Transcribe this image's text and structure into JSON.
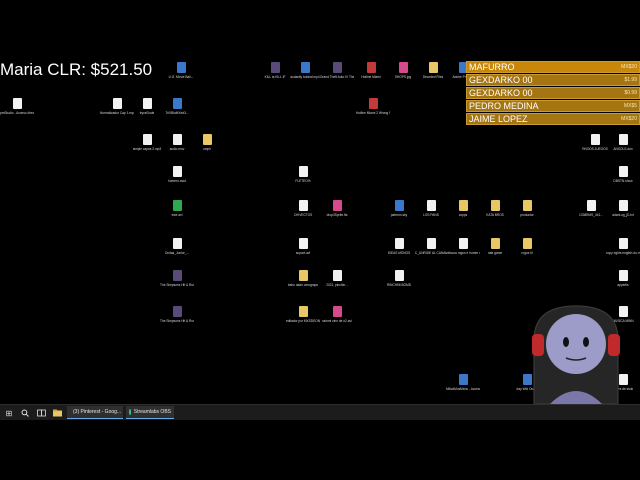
{
  "overlay": {
    "viewer_total": "Maria CLR: $521.50"
  },
  "donations": [
    {
      "name": "MAFURRO",
      "amount": "MX$20"
    },
    {
      "name": "GEXDARKO 00",
      "amount": "$1.99"
    },
    {
      "name": "GEXDARKO 00",
      "amount": "$0.99"
    },
    {
      "name": "PEDRO MEDINA",
      "amount": "MX$5"
    },
    {
      "name": "JAIME LOPEZ",
      "amount": "MX$20"
    }
  ],
  "desktop_icons": [
    {
      "label": "U.G. Movie Ball...",
      "kind": "blue"
    },
    {
      "label": "KILL la KILL IF",
      "kind": "game"
    },
    {
      "label": "audacity tutorial mp4",
      "kind": "blue"
    },
    {
      "label": "Grand Theft Auto IV The Complete...",
      "kind": "game"
    },
    {
      "label": "Hotline Miami",
      "kind": "red"
    },
    {
      "label": "SHOPS.jpg",
      "kind": "pink"
    },
    {
      "label": "Decoded Files",
      "kind": "folder"
    },
    {
      "label": "Adobe Pre Pro",
      "kind": "blue"
    },
    {
      "label": "pmStudio - Acceso directo",
      "kind": "file"
    },
    {
      "label": "Normalizador Cap 1.mp4",
      "kind": "file"
    },
    {
      "label": "tryceDude",
      "kind": "file"
    },
    {
      "label": "TriXBlaMXed3...",
      "kind": "blue"
    },
    {
      "label": "Hotline Miami 2 Wrong Number",
      "kind": "red"
    },
    {
      "label": "simple capas 2.mp3",
      "kind": "file"
    },
    {
      "label": "audio.mov",
      "kind": "file"
    },
    {
      "label": "umph",
      "kind": "folder"
    },
    {
      "label": "RNODS.JUEGOS",
      "kind": "file"
    },
    {
      "label": "ANSOLS.dun",
      "kind": "file"
    },
    {
      "label": "homero.mod",
      "kind": "file"
    },
    {
      "label": "FLETEO%",
      "kind": "file"
    },
    {
      "label": "DBSTN.show",
      "kind": "file"
    },
    {
      "label": "ewe.avi",
      "kind": "green"
    },
    {
      "label": "CHIVECTOS",
      "kind": "file"
    },
    {
      "label": "drop3Sprite.fla",
      "kind": "pink"
    },
    {
      "label": "patreon.sky",
      "kind": "blue"
    },
    {
      "label": "LOS PANS",
      "kind": "file"
    },
    {
      "label": "copps",
      "kind": "folder"
    },
    {
      "label": "KATA BROS",
      "kind": "folder"
    },
    {
      "label": "productor",
      "kind": "folder"
    },
    {
      "label": "1338RMS_341...",
      "kind": "file"
    },
    {
      "label": "adanLog_jD.txt",
      "kind": "file"
    },
    {
      "label": "Ondas_Junior_...",
      "kind": "file"
    },
    {
      "label": "scpoot.avi",
      "kind": "file"
    },
    {
      "label": "IDEAS MONOS",
      "kind": "file"
    },
    {
      "label": "C_UNRIDE AL CANAL",
      "kind": "file"
    },
    {
      "label": "milsoca rogus e homer du tncr...",
      "kind": "file"
    },
    {
      "label": "rafa game",
      "kind": "folder"
    },
    {
      "label": "rogus fil",
      "kind": "folder"
    },
    {
      "label": "copy rights english du.rn...",
      "kind": "file"
    },
    {
      "label": "The Simpsons Hit & Run by Mixer...",
      "kind": "game"
    },
    {
      "label": "baho dado omograpo",
      "kind": "folder"
    },
    {
      "label": "2021, pinchin...",
      "kind": "file"
    },
    {
      "label": "RINCH56 BOMD",
      "kind": "file"
    },
    {
      "label": "appeels",
      "kind": "file"
    },
    {
      "label": "The Simpsons Hit & Run by Mixe...",
      "kind": "game"
    },
    {
      "label": "editador por MXSDEON",
      "kind": "folder"
    },
    {
      "label": "ssinmi cinn de o2.avi",
      "kind": "pink"
    },
    {
      "label": "MUSICA MINN",
      "kind": "file"
    },
    {
      "label": "MilsolMusMenu - Acceso directo",
      "kind": "blue"
    },
    {
      "label": "day Wid Oca...",
      "kind": "blue"
    },
    {
      "label": "vedes de slulo",
      "kind": "file"
    }
  ],
  "taskbar": {
    "start_glyph": "⊞",
    "tasks": [
      {
        "label": "(3) Pinterest - Goog...",
        "color": "#dd4b39"
      },
      {
        "label": "Streamlabs OBS",
        "color": "#31c3a2"
      }
    ]
  }
}
